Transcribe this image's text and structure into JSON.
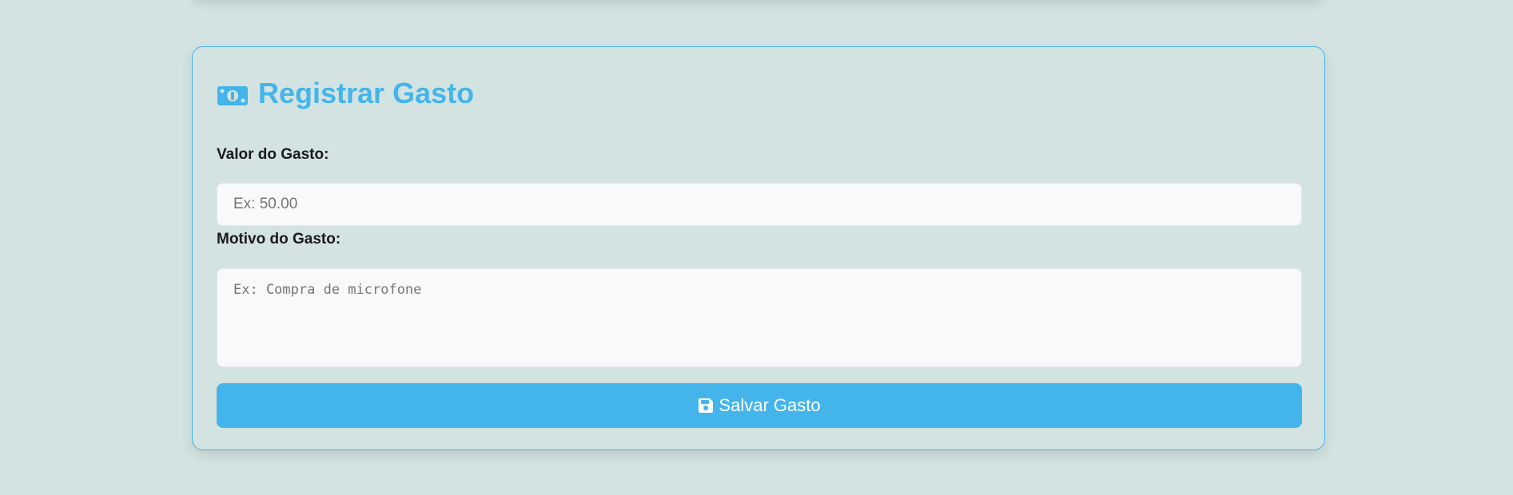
{
  "form": {
    "title": "Registrar Gasto",
    "title_icon": "money-bill-icon",
    "valor_label": "Valor do Gasto:",
    "valor_placeholder": "Ex: 50.00",
    "motivo_label": "Motivo do Gasto:",
    "motivo_placeholder": "Ex: Compra de microfone",
    "save_label": "Salvar Gasto",
    "save_icon": "floppy-disk-icon"
  },
  "colors": {
    "accent": "#44b5eb",
    "background": "#d3e3e1",
    "input_background": "#f7f9fa",
    "label_text": "#1a1a1a"
  }
}
